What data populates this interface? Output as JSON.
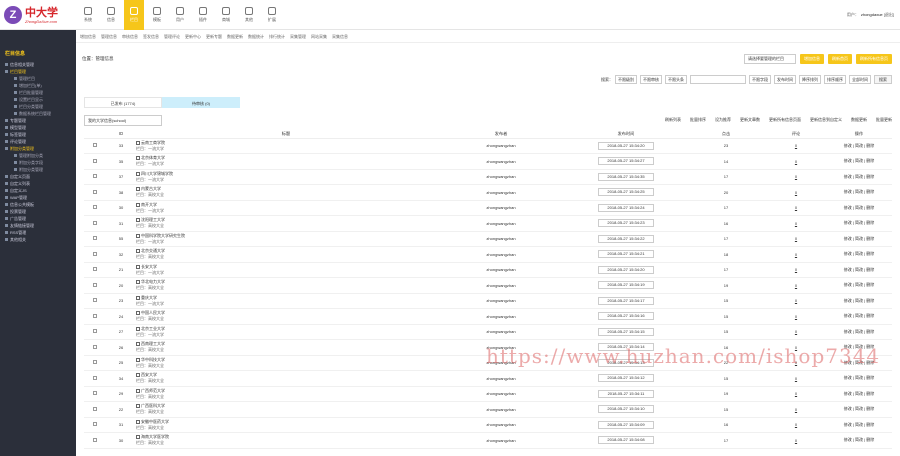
{
  "logo": {
    "mark": "Z",
    "cn": "中大学",
    "en": "ZhongDaXue.com"
  },
  "topnav": [
    {
      "label": "系统",
      "icon": "home-icon",
      "active": false
    },
    {
      "label": "信息",
      "icon": "info-icon",
      "active": false
    },
    {
      "label": "栏目",
      "icon": "list-icon",
      "active": true
    },
    {
      "label": "模板",
      "icon": "template-icon",
      "active": false
    },
    {
      "label": "用户",
      "icon": "user-icon",
      "active": false
    },
    {
      "label": "插件",
      "icon": "plugin-icon",
      "active": false
    },
    {
      "label": "商城",
      "icon": "shop-icon",
      "active": false
    },
    {
      "label": "其他",
      "icon": "other-icon",
      "active": false
    },
    {
      "label": "扩展",
      "icon": "plus-icon",
      "active": false
    }
  ],
  "user": {
    "label": "用户：",
    "name": "zhongdaxue",
    "suffix": "[退出]"
  },
  "subtabs": [
    "增加信息",
    "管理信息",
    "审核信息",
    "签发信息",
    "管理评论",
    "更新中心",
    "更新专题",
    "数据更新",
    "数据统计",
    "排行统计",
    "采集管理",
    "网站采集",
    "采集信息"
  ],
  "sidebar": {
    "head": "栏目信息",
    "items": [
      {
        "label": "信息相关管理",
        "type": "item",
        "hl": false
      },
      {
        "label": "栏目管理",
        "type": "item",
        "hl": true
      },
      {
        "label": "管理栏目",
        "type": "sub",
        "hl": false
      },
      {
        "label": "增加栏目(单)",
        "type": "sub",
        "hl": false
      },
      {
        "label": "栏目批量管理",
        "type": "sub",
        "hl": false
      },
      {
        "label": "设置栏目显示",
        "type": "sub",
        "hl": false
      },
      {
        "label": "栏目分类管理",
        "type": "sub",
        "hl": false
      },
      {
        "label": "数据系统栏目管理",
        "type": "sub",
        "hl": false
      },
      {
        "label": "专题管理",
        "type": "item",
        "hl": false
      },
      {
        "label": "模型管理",
        "type": "item",
        "hl": false
      },
      {
        "label": "标签管理",
        "type": "item",
        "hl": false
      },
      {
        "label": "评论管理",
        "type": "item",
        "hl": false
      },
      {
        "label": "附加分类管理",
        "type": "item",
        "hl": true
      },
      {
        "label": "管理附加分类",
        "type": "sub",
        "hl": false
      },
      {
        "label": "附加分类字段",
        "type": "sub",
        "hl": false
      },
      {
        "label": "附加分类管理",
        "type": "sub",
        "hl": false
      },
      {
        "label": "自定义页面",
        "type": "item",
        "hl": false
      },
      {
        "label": "自定义列表",
        "type": "item",
        "hl": false
      },
      {
        "label": "自定义JS",
        "type": "item",
        "hl": false
      },
      {
        "label": "WAP管理",
        "type": "item",
        "hl": false
      },
      {
        "label": "信息公共模板",
        "type": "item",
        "hl": false
      },
      {
        "label": "投票管理",
        "type": "item",
        "hl": false
      },
      {
        "label": "广告管理",
        "type": "item",
        "hl": false
      },
      {
        "label": "友情链接管理",
        "type": "item",
        "hl": false
      },
      {
        "label": "RSS管理",
        "type": "item",
        "hl": false
      },
      {
        "label": "其他相关",
        "type": "item",
        "hl": false
      }
    ]
  },
  "location": "位置：管理信息",
  "top_select": "请选择要管理的栏目",
  "top_buttons": [
    "增加信息",
    "刷新首页",
    "刷新所有信息页"
  ],
  "filters": {
    "label": "搜索：",
    "selects": [
      "不限级别",
      "不限审核",
      "不限头条"
    ],
    "field_select": "不限字段",
    "sort1": "发布时间",
    "sort2": "降序排列",
    "sort3": "排序顺序",
    "sort4": "全部时间",
    "button": "搜索"
  },
  "tabs": [
    {
      "label": "已发布 (1774)",
      "active": false
    },
    {
      "label": "待审核 (0)",
      "active": true
    }
  ],
  "category_select": "我的大学信息(school)",
  "actions": [
    "刷新列表",
    "批量排序",
    "设为推荐",
    "更新文章数",
    "更新所有信息页面",
    "更新信息到自定义",
    "数据更新",
    "批量更新"
  ],
  "columns": [
    "",
    "ID",
    "标题",
    "发布者",
    "发布时间",
    "点击",
    "评论",
    "操作"
  ],
  "ops_label": "修改 | 简改 | 删除",
  "rows": [
    {
      "id": "33",
      "title": "云南工商学院",
      "cat": "栏目：一流大学",
      "author": "zhongwangzhan",
      "date": "2018-05-27 15:34:20",
      "hits": "23",
      "comments": "0"
    },
    {
      "id": "35",
      "title": "北京体育大学",
      "cat": "栏目：一流大学",
      "author": "zhongwangzhan",
      "date": "2018-05-27 15:34:27",
      "hits": "14",
      "comments": "0"
    },
    {
      "id": "37",
      "title": "四川大学锦城学院",
      "cat": "栏目：一流大学",
      "author": "zhongwangzhan",
      "date": "2018-05-27 15:34:35",
      "hits": "17",
      "comments": "0"
    },
    {
      "id": "38",
      "title": "内蒙古大学",
      "cat": "栏目：高校大全",
      "author": "zhongwangzhan",
      "date": "2018-05-27 15:34:25",
      "hits": "20",
      "comments": "0"
    },
    {
      "id": "30",
      "title": "南开大学",
      "cat": "栏目：一流大学",
      "author": "zhongwangzhan",
      "date": "2018-05-27 15:34:24",
      "hits": "17",
      "comments": "0"
    },
    {
      "id": "31",
      "title": "沈阳理工大学",
      "cat": "栏目：高校大全",
      "author": "zhongwangzhan",
      "date": "2018-05-27 15:34:23",
      "hits": "16",
      "comments": "0"
    },
    {
      "id": "55",
      "title": "中国科学院大学研究生院",
      "cat": "栏目：一流大学",
      "author": "zhongwangzhan",
      "date": "2018-05-27 15:34:22",
      "hits": "17",
      "comments": "0"
    },
    {
      "id": "32",
      "title": "北京交通大学",
      "cat": "栏目：高校大全",
      "author": "zhongwangzhan",
      "date": "2018-05-27 15:34:21",
      "hits": "18",
      "comments": "0"
    },
    {
      "id": "21",
      "title": "长安大学",
      "cat": "栏目：一流大学",
      "author": "zhongwangzhan",
      "date": "2018-05-27 15:34:20",
      "hits": "17",
      "comments": "0"
    },
    {
      "id": "20",
      "title": "华北电力大学",
      "cat": "栏目：高校大全",
      "author": "zhongwangzhan",
      "date": "2018-05-27 15:34:19",
      "hits": "19",
      "comments": "0"
    },
    {
      "id": "23",
      "title": "重庆大学",
      "cat": "栏目：一流大学",
      "author": "zhongwangzhan",
      "date": "2018-05-27 15:34:17",
      "hits": "15",
      "comments": "0"
    },
    {
      "id": "24",
      "title": "中国人民大学",
      "cat": "栏目：高校大全",
      "author": "zhongwangzhan",
      "date": "2018-05-27 15:34:16",
      "hits": "15",
      "comments": "0"
    },
    {
      "id": "27",
      "title": "北京工业大学",
      "cat": "栏目：一流大学",
      "author": "zhongwangzhan",
      "date": "2018-05-27 15:34:15",
      "hits": "15",
      "comments": "0"
    },
    {
      "id": "26",
      "title": "西南理工大学",
      "cat": "栏目：高校大全",
      "author": "zhongwangzhan",
      "date": "2018-05-27 15:34:14",
      "hits": "16",
      "comments": "0"
    },
    {
      "id": "25",
      "title": "华中科技大学",
      "cat": "栏目：高校大全",
      "author": "zhongwangzhan",
      "date": "2018-05-27 15:34:13",
      "hits": "22",
      "comments": "0"
    },
    {
      "id": "34",
      "title": "西安大学",
      "cat": "栏目：高校大全",
      "author": "zhongwangzhan",
      "date": "2018-05-27 15:34:12",
      "hits": "15",
      "comments": "0"
    },
    {
      "id": "29",
      "title": "广西师范大学",
      "cat": "栏目：高校大全",
      "author": "zhongwangzhan",
      "date": "2018-05-27 15:34:11",
      "hits": "19",
      "comments": "0"
    },
    {
      "id": "22",
      "title": "广西医科大学",
      "cat": "栏目：高校大全",
      "author": "zhongwangzhan",
      "date": "2018-05-27 15:34:10",
      "hits": "15",
      "comments": "0"
    },
    {
      "id": "31",
      "title": "安徽中医药大学",
      "cat": "栏目：高校大全",
      "author": "zhongwangzhan",
      "date": "2018-05-27 15:34:09",
      "hits": "16",
      "comments": "0"
    },
    {
      "id": "30",
      "title": "海南大学医学院",
      "cat": "栏目：高校大全",
      "author": "zhongwangzhan",
      "date": "2018-05-27 15:34:08",
      "hits": "17",
      "comments": "0"
    }
  ],
  "watermark": "https://www.huzhan.com/ishop7344",
  "colors": {
    "accent": "#f6c61a",
    "sidebar": "#2b2f3a",
    "tab_active": "#cdeefb"
  }
}
